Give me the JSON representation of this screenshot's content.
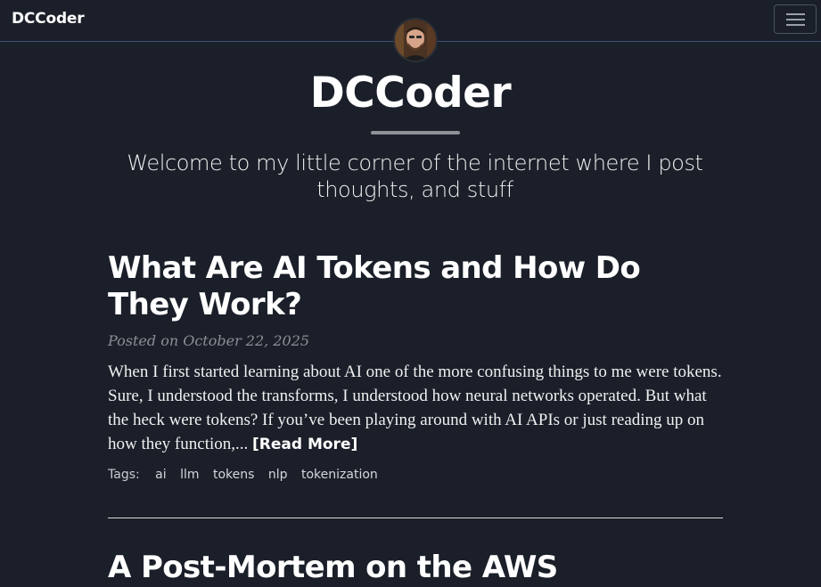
{
  "nav": {
    "brand": "DCCoder"
  },
  "hero": {
    "title": "DCCoder",
    "subtitle": "Welcome to my little corner of the internet where I post thoughts, and stuff"
  },
  "posts": [
    {
      "title": "What Are AI Tokens and How Do They Work?",
      "meta": "Posted on October 22, 2025",
      "excerpt": "When I first started learning about AI one of the more confusing things to me were tokens. Sure, I understood the transforms, I understood how neural networks operated. But what the heck were tokens? If you’ve been playing around with AI APIs or just reading up on how they function,...",
      "read_more": "[Read More]",
      "tags_label": "Tags:",
      "tags": [
        "ai",
        "llm",
        "tokens",
        "nlp",
        "tokenization"
      ]
    },
    {
      "title": "A Post-Mortem on the AWS"
    }
  ]
}
